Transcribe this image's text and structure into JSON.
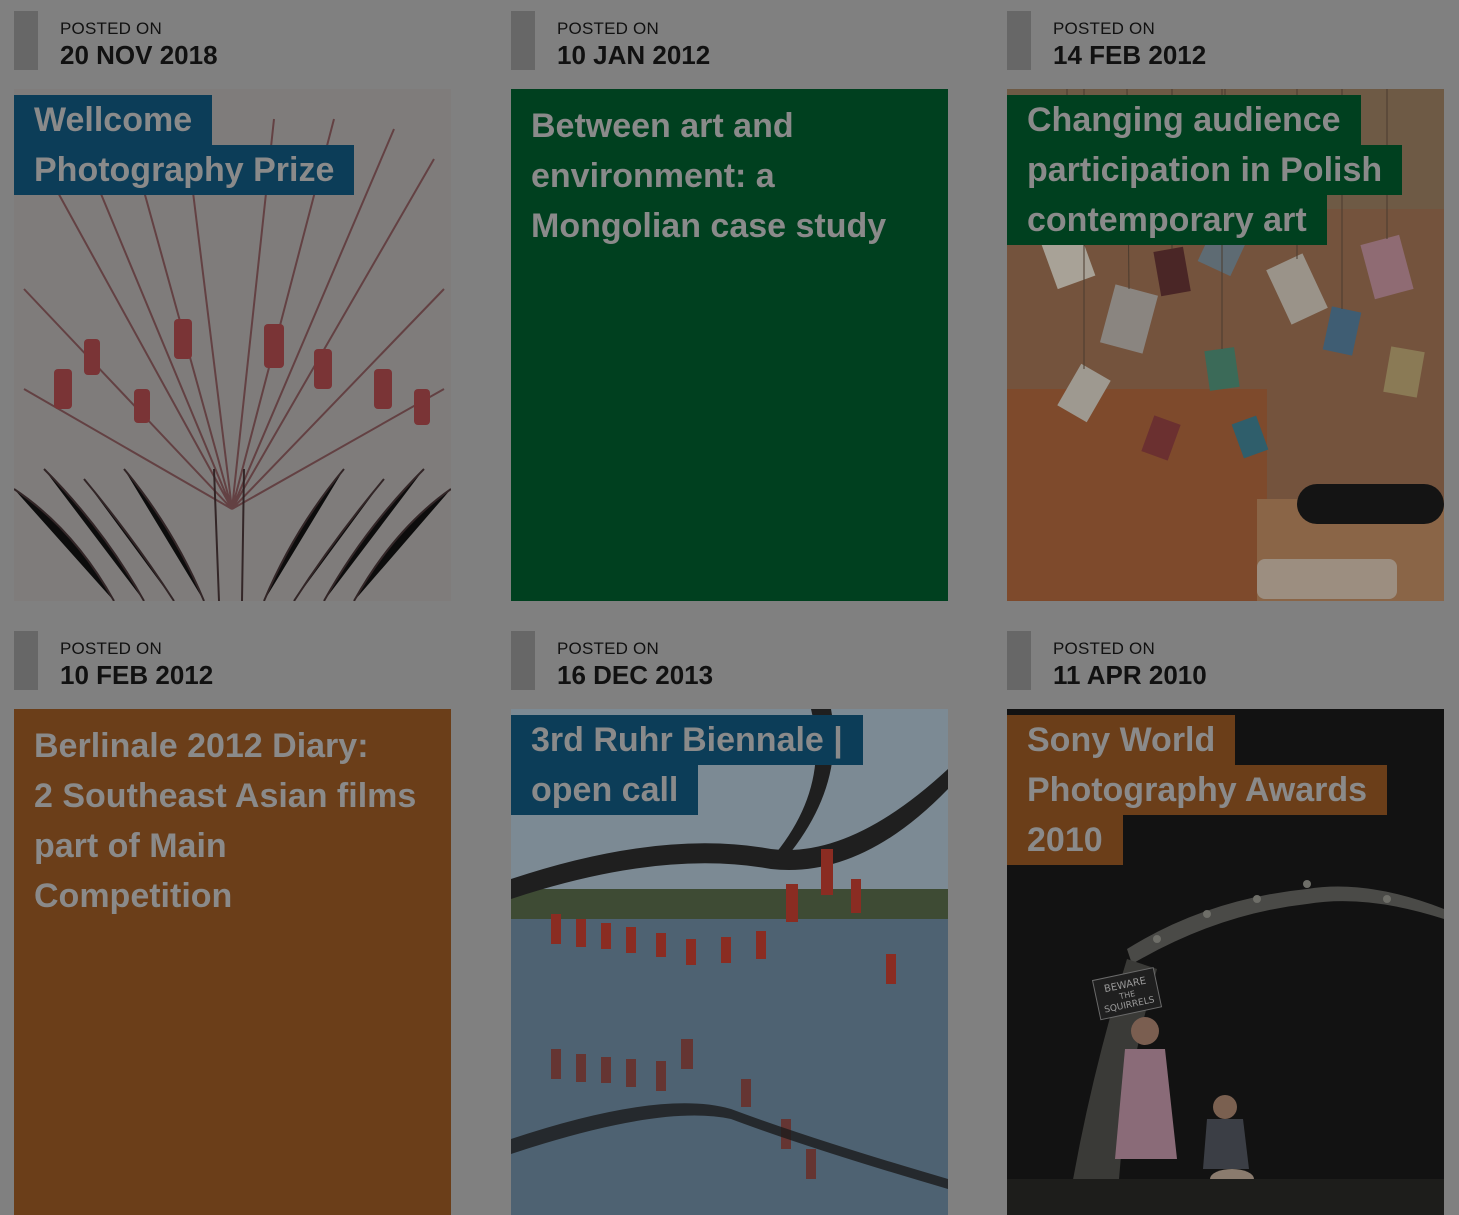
{
  "posts": [
    {
      "posted_label": "POSTED ON",
      "date": "20 NOV 2018",
      "title_lines": [
        "Wellcome",
        "Photography Prize"
      ],
      "title_bg": "#0c3d58",
      "image": "installation-of-hanging-pods"
    },
    {
      "posted_label": "POSTED ON",
      "date": "10 JAN 2012",
      "title_lines": [
        "Between art and",
        "environment: a",
        "Mongolian case study"
      ],
      "title_bg": "#00401f",
      "image": null
    },
    {
      "posted_label": "POSTED ON",
      "date": "14 FEB 2012",
      "title_lines": [
        "Changing audience",
        "participation in Polish",
        "contemporary art"
      ],
      "title_bg": "#00401f",
      "image": "room-with-hanging-books"
    },
    {
      "posted_label": "POSTED ON",
      "date": "10 FEB 2012",
      "title_lines": [
        "Berlinale 2012 Diary:",
        "2 Southeast Asian films",
        "part of Main",
        "Competition"
      ],
      "title_bg": "#6b3e19",
      "image": null
    },
    {
      "posted_label": "POSTED ON",
      "date": "16 DEC 2013",
      "title_lines": [
        "3rd Ruhr Biennale |",
        "open call"
      ],
      "title_bg": "#0c3d58",
      "image": "lake-with-hanging-bottles"
    },
    {
      "posted_label": "POSTED ON",
      "date": "11 APR 2010",
      "title_lines": [
        "Sony World",
        "Photography Awards",
        "2010"
      ],
      "title_bg": "#6b3e19",
      "image": "child-in-dark-forest",
      "sign_text": [
        "BEWARE",
        "THE",
        "SQUIRRELS"
      ]
    }
  ]
}
